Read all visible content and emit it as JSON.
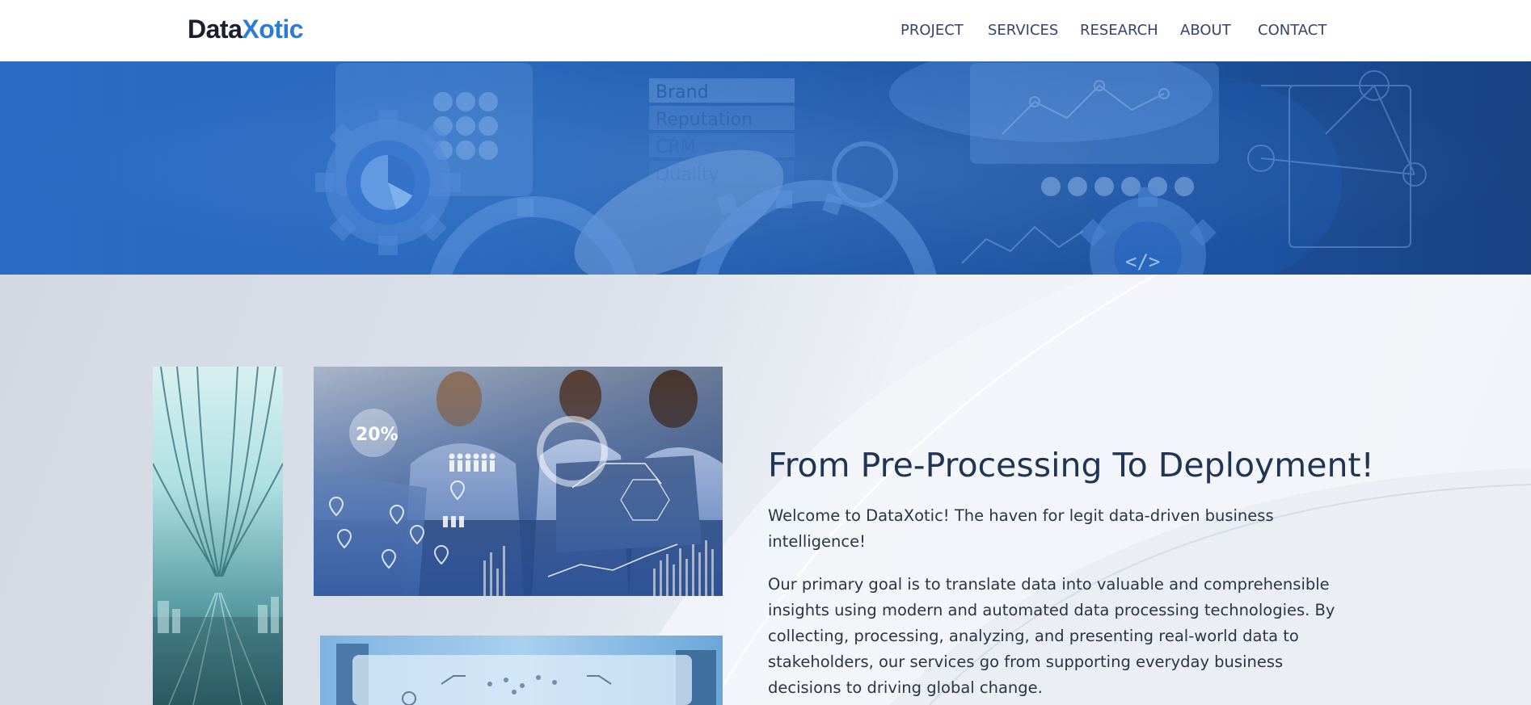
{
  "header": {
    "logo_part1": "Data",
    "logo_part2": "Xotic",
    "nav": [
      "PROJECT",
      "SERVICES",
      "RESEARCH",
      "ABOUT",
      "CONTACT"
    ]
  },
  "hero": {
    "overlay_words": [
      "Brand",
      "Reputation",
      "CRM",
      "Quality"
    ]
  },
  "main": {
    "badge_text": "20%",
    "heading": "From Pre-Processing To Deployment!",
    "paragraph1": "Welcome to DataXotic! The haven for legit data-driven business intelligence!",
    "paragraph2": "Our primary goal is to translate data into valuable and comprehensible insights using modern and automated data processing technologies. By collecting, processing, analyzing, and presenting real-world data to stakeholders, our services go from supporting everyday business decisions to driving global change."
  },
  "colors": {
    "brand_blue": "#2b7bd8",
    "hero_blue": "#2f75d1",
    "heading_navy": "#1f3553",
    "nav_text": "#37456a"
  },
  "icons": [
    "gear-icon",
    "pie-chart-icon",
    "code-gear-icon",
    "people-icon",
    "location-pin-icon"
  ]
}
